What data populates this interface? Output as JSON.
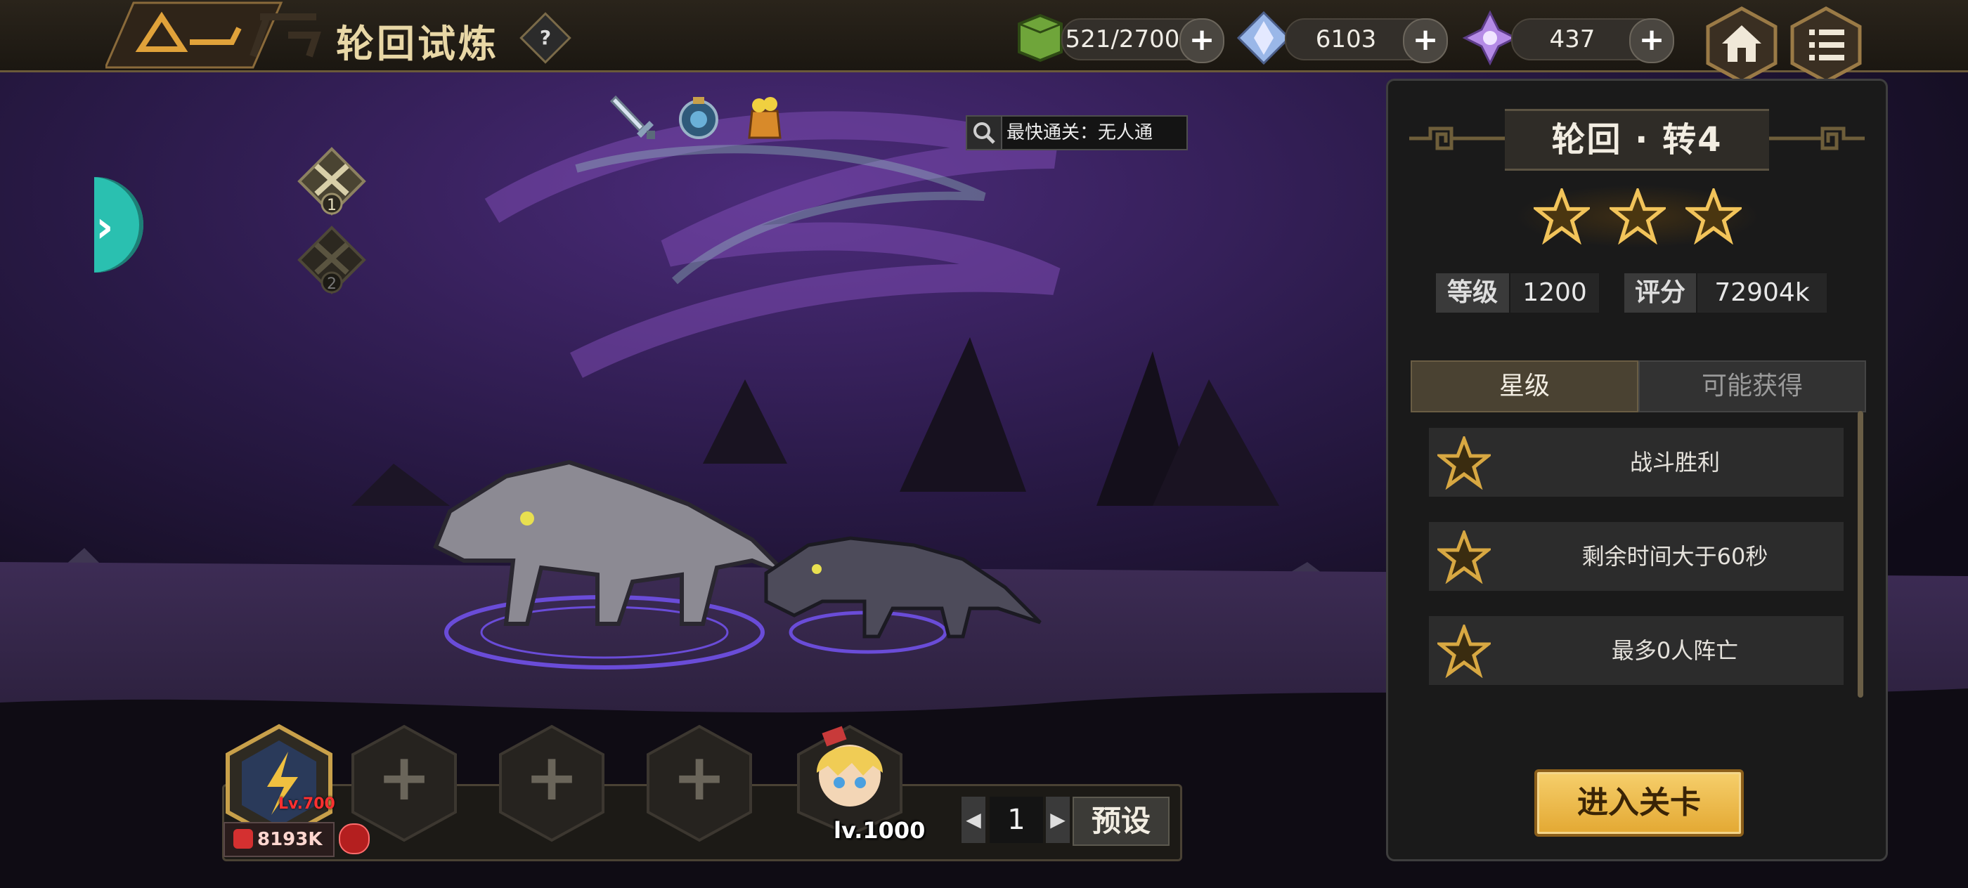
{
  "header": {
    "title": "轮回试炼",
    "help_symbol": "?",
    "stamina": "521/2700",
    "crystals": "6103",
    "gems": "437",
    "plus_symbol": "+"
  },
  "stage": {
    "fastest_clear": "最快通关：无人通",
    "markers": [
      "1",
      "2"
    ],
    "drop_icons": [
      "sword-icon",
      "relic-orb-icon",
      "potion-jar-icon"
    ]
  },
  "panel": {
    "title": "轮回 · 转4",
    "stars_earned": 3,
    "level_label": "等级",
    "level_value": "1200",
    "score_label": "评分",
    "score_value": "72904k",
    "tabs": {
      "stars": "星级",
      "rewards": "可能获得"
    },
    "conditions": [
      "战斗胜利",
      "剩余时间大于60秒",
      "最多0人阵亡"
    ],
    "enter_button": "进入关卡"
  },
  "team": {
    "hero_level": "Lv.700",
    "power": "8193K",
    "captain_level": "lv.1000",
    "page": "1",
    "prev_symbol": "◀",
    "next_symbol": "▶",
    "preset_label": "预设",
    "empty_slot_symbol": "+"
  },
  "colors": {
    "accent_gold": "#e3a832",
    "teal": "#2ac0b0",
    "bg_purple": "#2a1a48"
  }
}
